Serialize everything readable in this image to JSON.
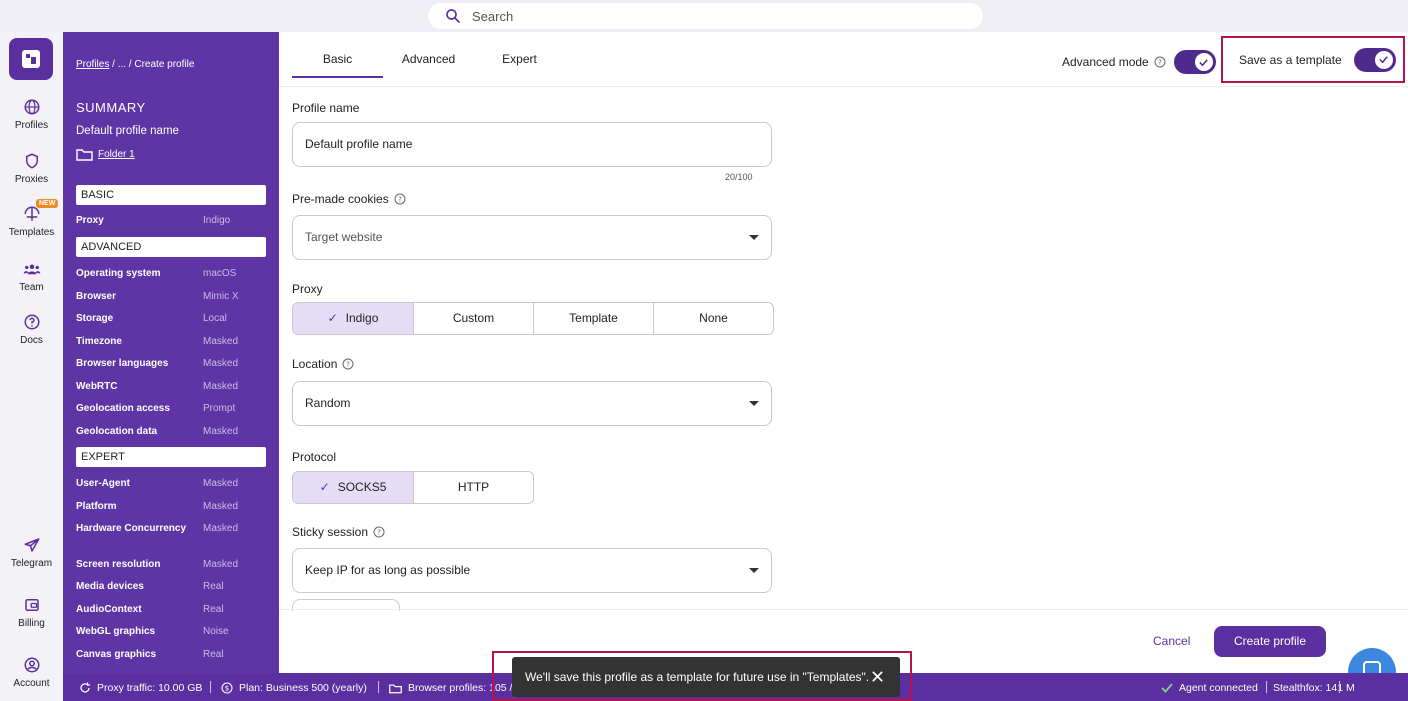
{
  "search": {
    "placeholder": "Search"
  },
  "rail": {
    "items": [
      {
        "label": "Profiles"
      },
      {
        "label": "Proxies"
      },
      {
        "label": "Templates",
        "badge": "NEW"
      },
      {
        "label": "Team"
      },
      {
        "label": "Docs"
      },
      {
        "label": "Telegram"
      },
      {
        "label": "Billing"
      },
      {
        "label": "Account"
      }
    ]
  },
  "summary": {
    "breadcrumb": {
      "root": "Profiles",
      "rest": " / ... / Create profile"
    },
    "title": "SUMMARY",
    "profile_name": "Default profile name",
    "folder": "Folder 1",
    "sections": {
      "basic": "BASIC",
      "advanced": "ADVANCED",
      "expert": "EXPERT"
    },
    "basic_rows": [
      {
        "k": "Proxy",
        "v": "Indigo"
      }
    ],
    "advanced_rows": [
      {
        "k": "Operating system",
        "v": "macOS"
      },
      {
        "k": "Browser",
        "v": "Mimic X"
      },
      {
        "k": "Storage",
        "v": "Local"
      },
      {
        "k": "Timezone",
        "v": "Masked"
      },
      {
        "k": "Browser languages",
        "v": "Masked"
      },
      {
        "k": "WebRTC",
        "v": "Masked"
      },
      {
        "k": "Geolocation access",
        "v": "Prompt"
      },
      {
        "k": "Geolocation data",
        "v": "Masked"
      }
    ],
    "expert_rows": [
      {
        "k": "User-Agent",
        "v": "Masked"
      },
      {
        "k": "Platform",
        "v": "Masked"
      },
      {
        "k": "Hardware Concurrency",
        "v": "Masked"
      },
      {
        "k": "Screen resolution",
        "v": "Masked"
      },
      {
        "k": "Media devices",
        "v": "Real"
      },
      {
        "k": "AudioContext",
        "v": "Real"
      },
      {
        "k": "WebGL graphics",
        "v": "Noise"
      },
      {
        "k": "Canvas graphics",
        "v": "Real"
      }
    ]
  },
  "tabs": [
    "Basic",
    "Advanced",
    "Expert"
  ],
  "header": {
    "advanced_mode": "Advanced mode",
    "save_template": "Save as a template"
  },
  "form": {
    "profile_name_label": "Profile name",
    "profile_name_value": "Default profile name",
    "profile_name_counter": "20/100",
    "cookies_label": "Pre-made cookies",
    "cookies_placeholder": "Target website",
    "proxy_label": "Proxy",
    "proxy_options": [
      "Indigo",
      "Custom",
      "Template",
      "None"
    ],
    "location_label": "Location",
    "location_value": "Random",
    "protocol_label": "Protocol",
    "protocol_options": [
      "SOCKS5",
      "HTTP"
    ],
    "sticky_label": "Sticky session",
    "sticky_value": "Keep IP for as long as possible"
  },
  "actions": {
    "cancel": "Cancel",
    "create": "Create profile"
  },
  "toast": {
    "message": "We'll save this profile as a template for future use in \"Templates\"."
  },
  "status": {
    "proxy_traffic": "Proxy traffic: 10.00 GB",
    "plan": "Plan: Business 500 (yearly)",
    "browser_profiles": "Browser profiles: 105 /",
    "agent": "Agent connected",
    "stealthfox": "Stealthfox: 141",
    "mimic": "M"
  },
  "colors": {
    "brand": "#5b2fa0",
    "highlight": "#b5124f",
    "chat": "#3c88e0"
  }
}
